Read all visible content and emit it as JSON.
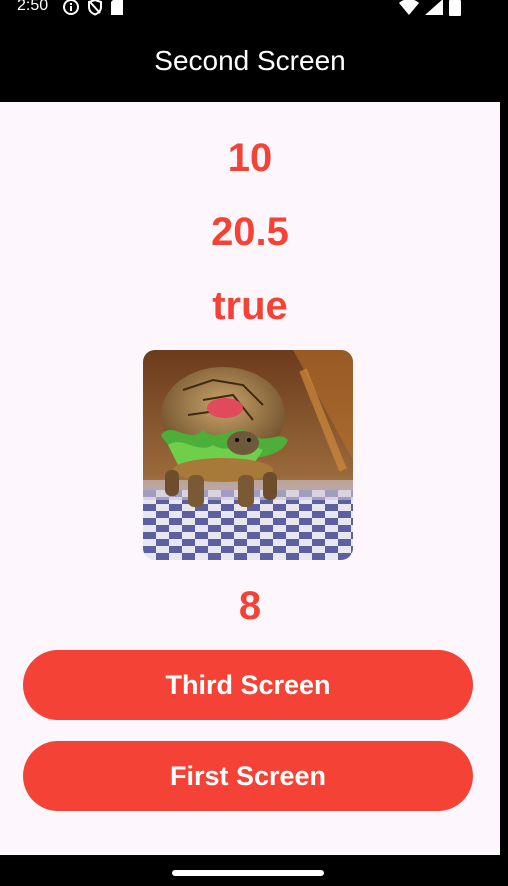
{
  "status_bar": {
    "time": "2:50"
  },
  "app_bar": {
    "title": "Second Screen"
  },
  "values": [
    "10",
    "20.5",
    "true",
    "8"
  ],
  "buttons": {
    "third": "Third Screen",
    "first": "First Screen"
  },
  "colors": {
    "accent": "#f44336",
    "background": "#fdf7fd",
    "bar": "#000000"
  },
  "icons": [
    "info-icon",
    "shield-icon",
    "sd-card-icon",
    "wifi-icon",
    "signal-icon",
    "battery-icon"
  ]
}
